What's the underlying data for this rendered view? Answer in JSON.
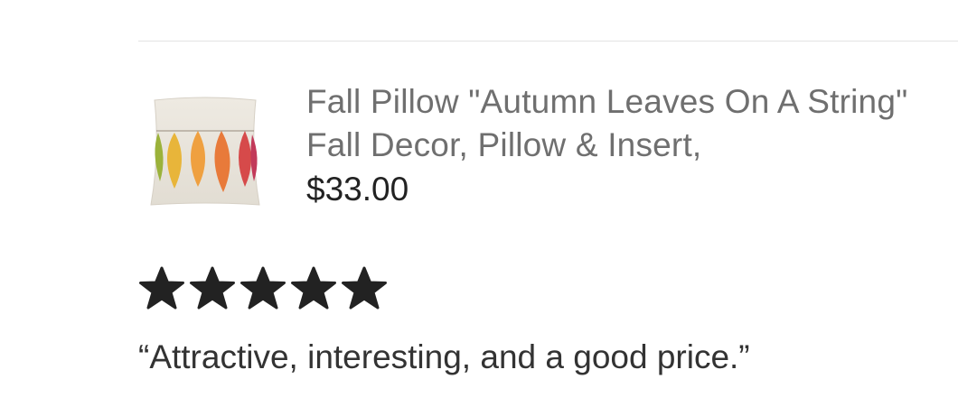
{
  "product": {
    "title": "Fall Pillow \"Autumn Leaves On A String\" Fall Decor, Pillow & Insert,",
    "price": "$33.00",
    "image_icon": "autumn-leaves-pillow-image"
  },
  "review": {
    "rating": 5,
    "rating_max": 5,
    "text": "“Attractive, interesting, and a good price.”"
  },
  "colors": {
    "star": "#222222",
    "title": "#6f6f6f",
    "price": "#222222",
    "divider": "#e4e4e4"
  }
}
